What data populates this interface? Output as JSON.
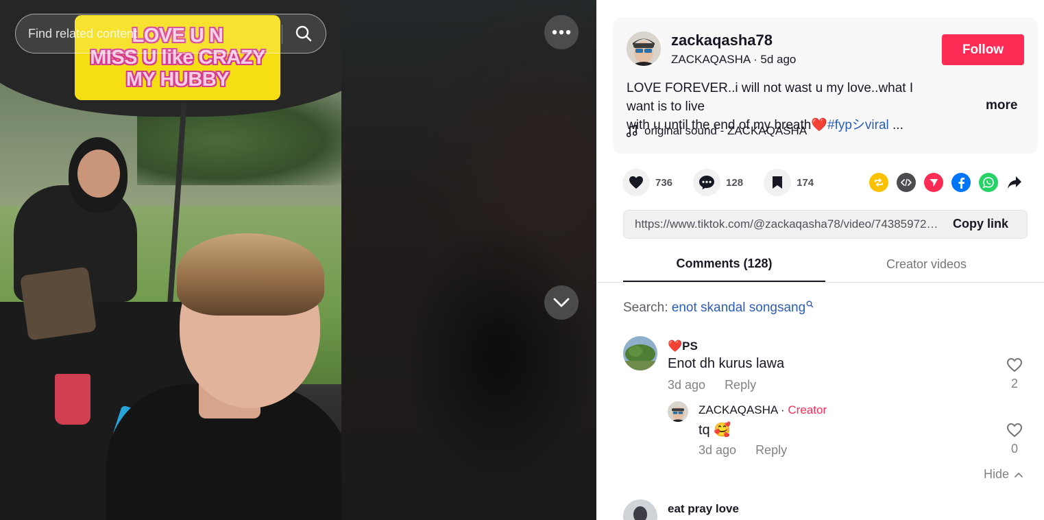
{
  "search": {
    "placeholder": "Find related content"
  },
  "video": {
    "caption_lines": [
      "LOVE U N",
      "MISS U like CRAZY",
      "MY HUBBY"
    ]
  },
  "post": {
    "username": "zackaqasha78",
    "nickname": "ZACKAQASHA",
    "time_ago": "5d ago",
    "follow_label": "Follow",
    "description_line1": "LOVE FOREVER..i will not wast u my love..what I want is to live",
    "description_line2": "with u until the end of my breath",
    "heart_emoji": "❤️",
    "hashtag": "#fypシviral",
    "ellipsis": " ...",
    "more_label": "more",
    "music": "original sound - ZACKAQASHA"
  },
  "stats": {
    "likes": "736",
    "comments": "128",
    "saves": "174"
  },
  "share": {
    "link": "https://www.tiktok.com/@zackaqasha78/video/7438597262843301127",
    "copy_label": "Copy link",
    "colors": {
      "repost": "#fcc100",
      "embed": "#4b4b50",
      "send": "#fe2c55",
      "facebook": "#0075fa",
      "whatsapp": "#25d366"
    }
  },
  "tabs": {
    "comments": "Comments (128)",
    "creator": "Creator videos"
  },
  "search_suggest": {
    "prefix": "Search: ",
    "keyword": "enot skandal songsang"
  },
  "comments": [
    {
      "name": "❤️PS",
      "text": "Enot dh kurus lawa",
      "time": "3d ago",
      "reply_label": "Reply",
      "likes": "2",
      "replies": [
        {
          "name": "ZACKAQASHA",
          "separator": " · ",
          "tag": "Creator",
          "text": "tq 🥰",
          "time": "3d ago",
          "reply_label": "Reply",
          "likes": "0"
        }
      ],
      "hide_label": "Hide"
    },
    {
      "name": "eat pray love"
    }
  ]
}
